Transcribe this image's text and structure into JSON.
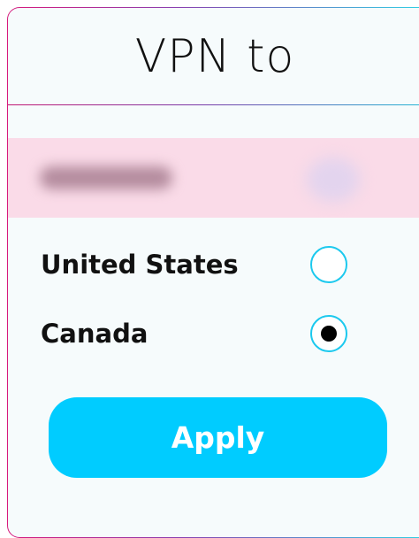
{
  "dialog": {
    "title": "VPN to"
  },
  "current_selection": {
    "obscured": true
  },
  "options": [
    {
      "label": "United States",
      "selected": false
    },
    {
      "label": "Canada",
      "selected": true
    }
  ],
  "apply_button": {
    "label": "Apply"
  },
  "colors": {
    "accent": "#00ccff",
    "radio_border": "#1cc9ee",
    "highlight_row": "#fadbe8",
    "border_gradient_start": "#d8197c",
    "border_gradient_end": "#2ed4e6",
    "panel_background": "#f6fbfc"
  }
}
